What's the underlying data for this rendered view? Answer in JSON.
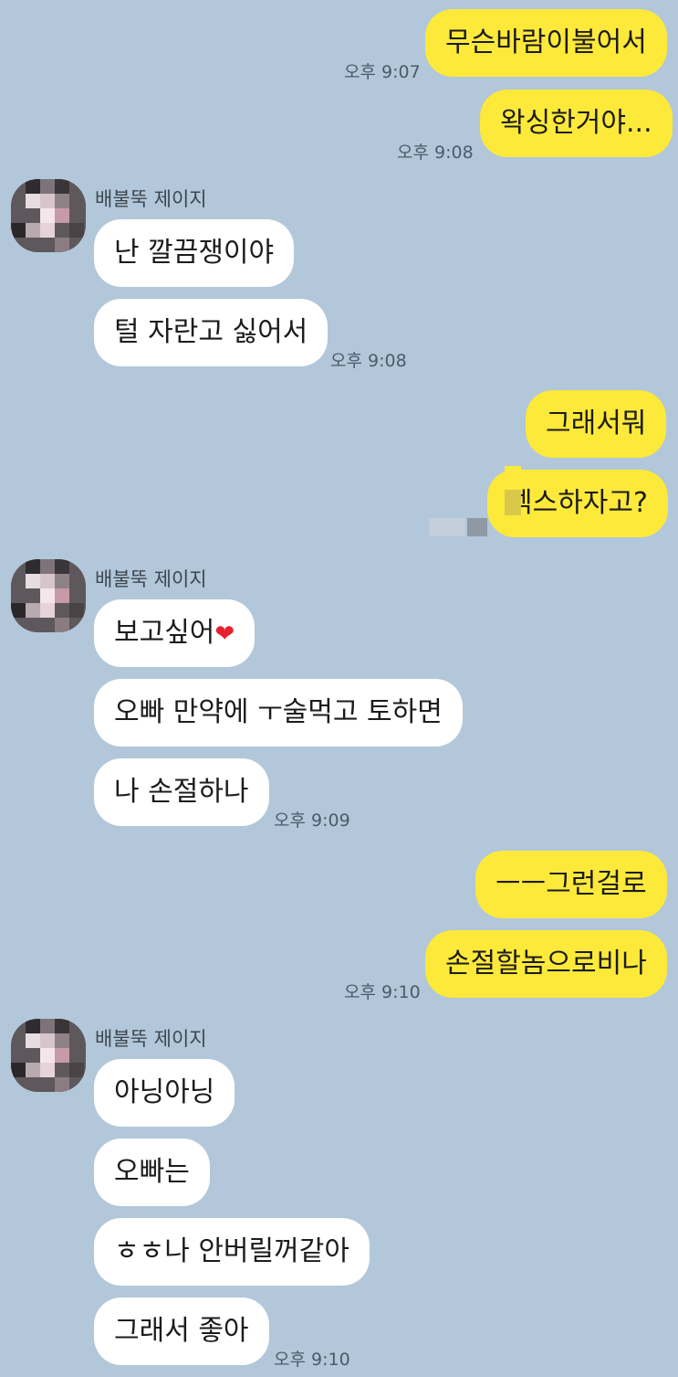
{
  "messages": [
    {
      "side": "me",
      "text": "무슨바람이불어서",
      "time": "오후 9:07"
    },
    {
      "side": "me",
      "text": "왁싱한거야...",
      "time": "오후 9:08"
    },
    {
      "sender": "배불뚝 제이지"
    },
    {
      "side": "them",
      "text": "난 깔끔쟁이야"
    },
    {
      "side": "them",
      "text": "털 자란고 싫어서",
      "time": "오후 9:08"
    },
    {
      "side": "me",
      "text": "그래서뭐"
    },
    {
      "side": "me",
      "text": "섹스하자고?"
    },
    {
      "sender": "배불뚝 제이지"
    },
    {
      "side": "them",
      "text": "보고싶어",
      "emoji": "❤"
    },
    {
      "side": "them",
      "text": "오빠 만약에 ㅜ술먹고 토하면"
    },
    {
      "side": "them",
      "text": "나 손절하나",
      "time": "오후 9:09"
    },
    {
      "side": "me",
      "text": "ㅡㅡ그런걸로"
    },
    {
      "side": "me",
      "text": "손절할놈으로비나",
      "time": "오후 9:10"
    },
    {
      "sender": "배불뚝 제이지"
    },
    {
      "side": "them",
      "text": "아닝아닝"
    },
    {
      "side": "them",
      "text": "오빠는"
    },
    {
      "side": "them",
      "text": "ㅎㅎ나 안버릴꺼같아"
    },
    {
      "side": "them",
      "text": "그래서 좋아",
      "time": "오후 9:10"
    }
  ],
  "colors": {
    "background": "#b2c7da",
    "my_bubble": "#fde93a",
    "their_bubble": "#ffffff"
  }
}
